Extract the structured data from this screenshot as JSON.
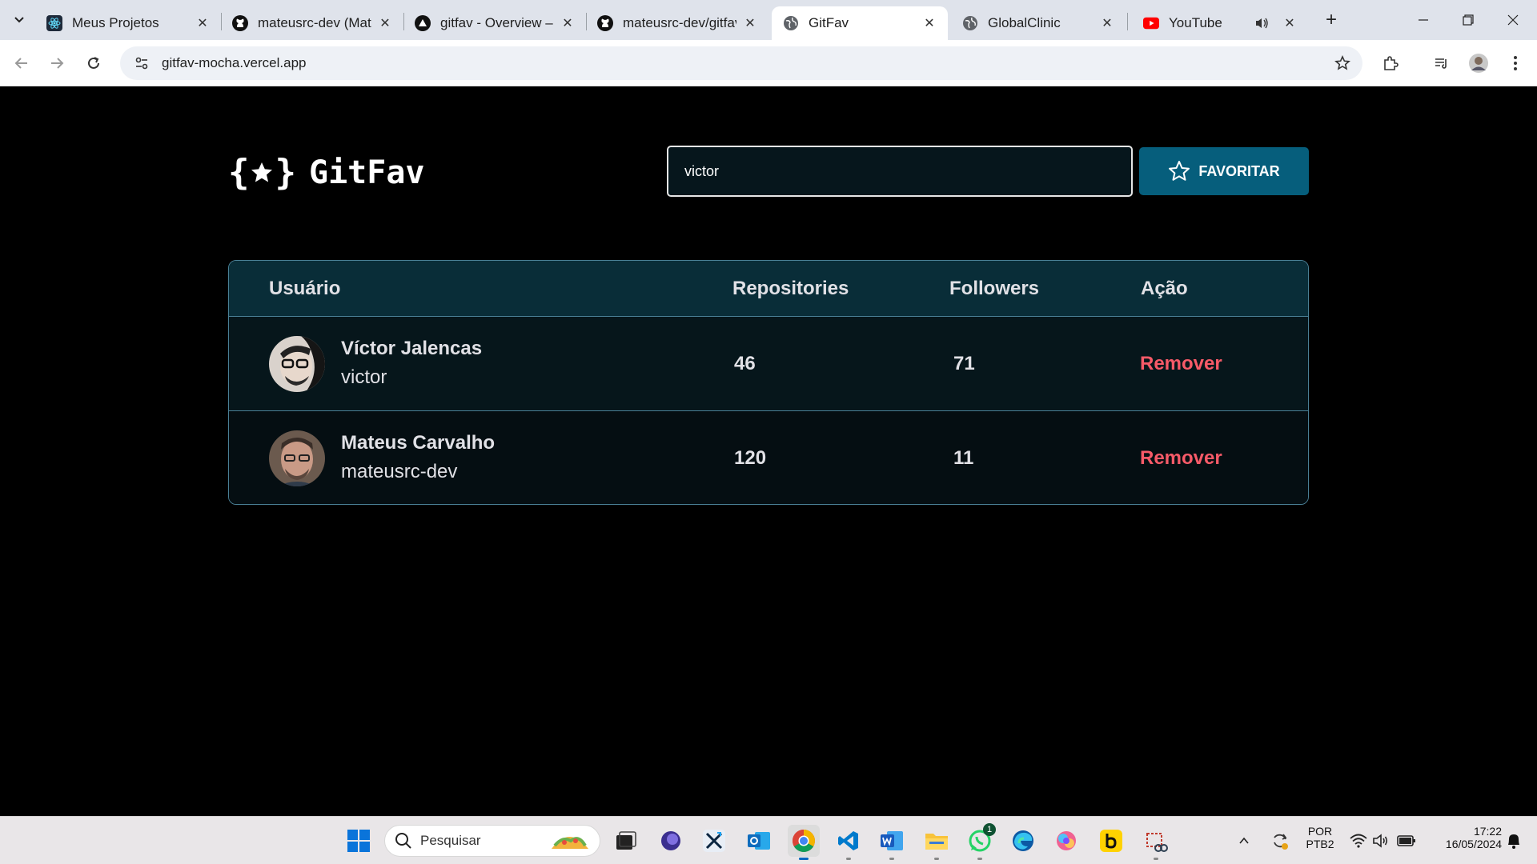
{
  "browser": {
    "tabs": [
      {
        "title": "Meus Projetos",
        "icon": "react-icon"
      },
      {
        "title": "mateusrc-dev (Mateu",
        "icon": "github-icon"
      },
      {
        "title": "gitfav - Overview – V",
        "icon": "vercel-icon"
      },
      {
        "title": "mateusrc-dev/gitfav",
        "icon": "github-icon"
      },
      {
        "title": "GitFav",
        "icon": "globe-icon",
        "active": true
      },
      {
        "title": "GlobalClinic",
        "icon": "globe-icon"
      },
      {
        "title": "YouTube",
        "icon": "youtube-icon"
      }
    ],
    "url": "gitfav-mocha.vercel.app"
  },
  "app": {
    "logo": "{★}",
    "logo_open": "{",
    "logo_close": "}",
    "name": "GitFav",
    "search_value": "victor",
    "favorite_label": "FAVORITAR"
  },
  "table": {
    "headers": [
      "Usuário",
      "Repositories",
      "Followers",
      "Ação"
    ],
    "rows": [
      {
        "name": "Víctor Jalencas",
        "login": "victor",
        "repositories": "46",
        "followers": "71",
        "action": "Remover"
      },
      {
        "name": "Mateus Carvalho",
        "login": "mateusrc-dev",
        "repositories": "120",
        "followers": "11",
        "action": "Remover"
      }
    ]
  },
  "taskbar": {
    "search_placeholder": "Pesquisar",
    "language": "POR",
    "keyboard": "PTB2",
    "time": "17:22",
    "date": "16/05/2024",
    "whatsapp_badge": "1"
  },
  "colors": {
    "background": "#000000",
    "accent": "#065e7c",
    "table_header": "#092d38",
    "remove": "#f75a68",
    "border": "#4a8096"
  }
}
